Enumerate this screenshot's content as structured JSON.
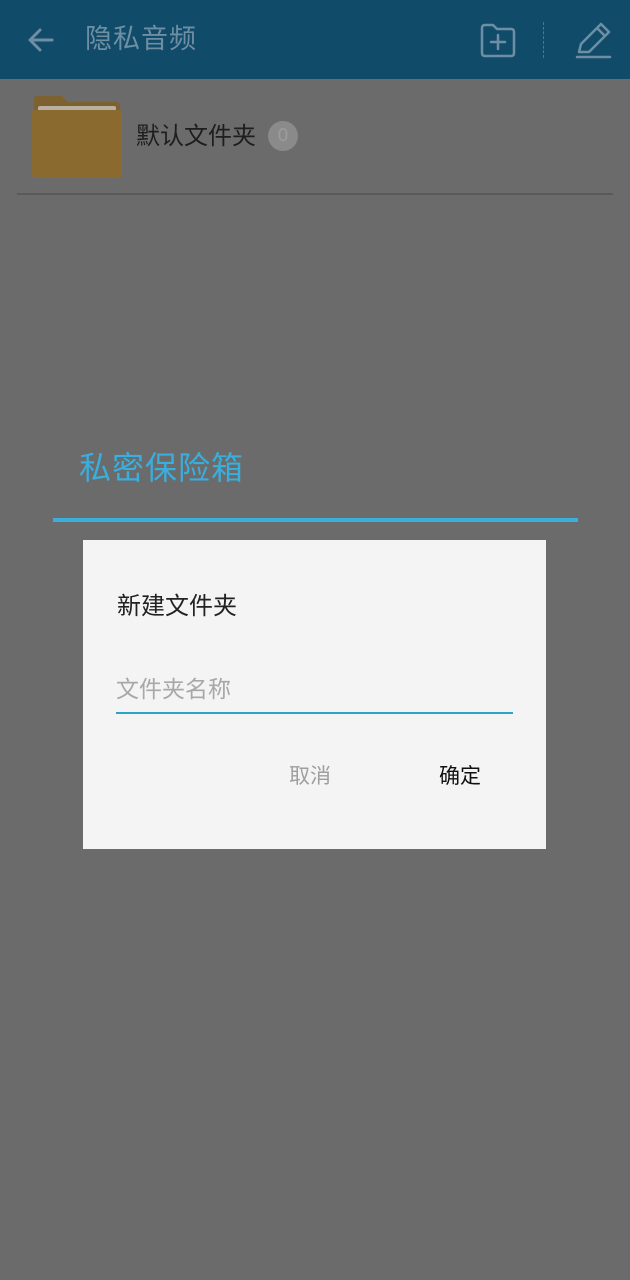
{
  "app_bar": {
    "title": "隐私音频",
    "back_icon": "arrow-left-icon",
    "new_folder_icon": "folder-plus-icon",
    "edit_icon": "pencil-icon",
    "background_color": "#114b6a"
  },
  "folders": [
    {
      "name": "默认文件夹",
      "count": "0",
      "folder_color": "#8a6a2e"
    }
  ],
  "vault_dialog": {
    "title": "私密保险箱",
    "accent_color": "#3aaedc"
  },
  "new_folder_dialog": {
    "title": "新建文件夹",
    "input": {
      "value": "",
      "placeholder": "文件夹名称"
    },
    "cancel_label": "取消",
    "confirm_label": "确定"
  }
}
